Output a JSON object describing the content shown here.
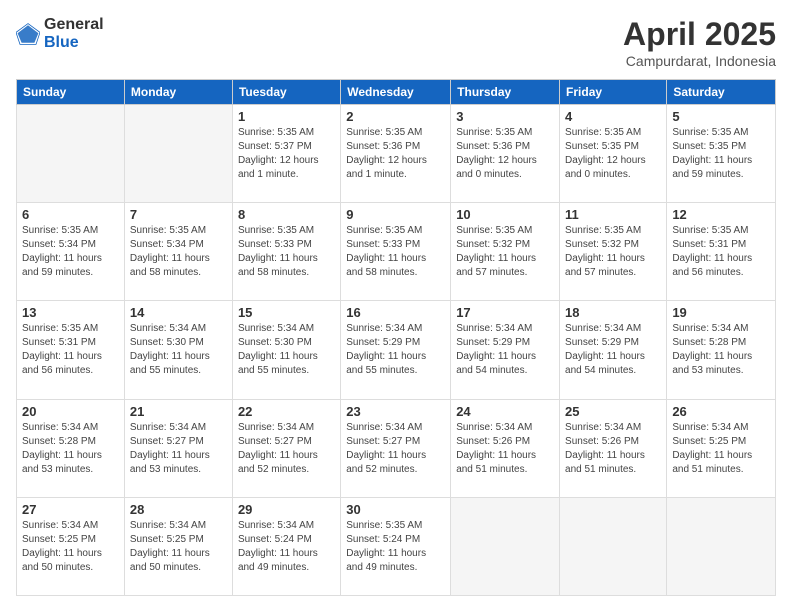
{
  "logo": {
    "general": "General",
    "blue": "Blue"
  },
  "header": {
    "title": "April 2025",
    "subtitle": "Campurdarat, Indonesia"
  },
  "columns": [
    "Sunday",
    "Monday",
    "Tuesday",
    "Wednesday",
    "Thursday",
    "Friday",
    "Saturday"
  ],
  "weeks": [
    [
      {
        "day": "",
        "info": ""
      },
      {
        "day": "",
        "info": ""
      },
      {
        "day": "1",
        "info": "Sunrise: 5:35 AM\nSunset: 5:37 PM\nDaylight: 12 hours and 1 minute."
      },
      {
        "day": "2",
        "info": "Sunrise: 5:35 AM\nSunset: 5:36 PM\nDaylight: 12 hours and 1 minute."
      },
      {
        "day": "3",
        "info": "Sunrise: 5:35 AM\nSunset: 5:36 PM\nDaylight: 12 hours and 0 minutes."
      },
      {
        "day": "4",
        "info": "Sunrise: 5:35 AM\nSunset: 5:35 PM\nDaylight: 12 hours and 0 minutes."
      },
      {
        "day": "5",
        "info": "Sunrise: 5:35 AM\nSunset: 5:35 PM\nDaylight: 11 hours and 59 minutes."
      }
    ],
    [
      {
        "day": "6",
        "info": "Sunrise: 5:35 AM\nSunset: 5:34 PM\nDaylight: 11 hours and 59 minutes."
      },
      {
        "day": "7",
        "info": "Sunrise: 5:35 AM\nSunset: 5:34 PM\nDaylight: 11 hours and 58 minutes."
      },
      {
        "day": "8",
        "info": "Sunrise: 5:35 AM\nSunset: 5:33 PM\nDaylight: 11 hours and 58 minutes."
      },
      {
        "day": "9",
        "info": "Sunrise: 5:35 AM\nSunset: 5:33 PM\nDaylight: 11 hours and 58 minutes."
      },
      {
        "day": "10",
        "info": "Sunrise: 5:35 AM\nSunset: 5:32 PM\nDaylight: 11 hours and 57 minutes."
      },
      {
        "day": "11",
        "info": "Sunrise: 5:35 AM\nSunset: 5:32 PM\nDaylight: 11 hours and 57 minutes."
      },
      {
        "day": "12",
        "info": "Sunrise: 5:35 AM\nSunset: 5:31 PM\nDaylight: 11 hours and 56 minutes."
      }
    ],
    [
      {
        "day": "13",
        "info": "Sunrise: 5:35 AM\nSunset: 5:31 PM\nDaylight: 11 hours and 56 minutes."
      },
      {
        "day": "14",
        "info": "Sunrise: 5:34 AM\nSunset: 5:30 PM\nDaylight: 11 hours and 55 minutes."
      },
      {
        "day": "15",
        "info": "Sunrise: 5:34 AM\nSunset: 5:30 PM\nDaylight: 11 hours and 55 minutes."
      },
      {
        "day": "16",
        "info": "Sunrise: 5:34 AM\nSunset: 5:29 PM\nDaylight: 11 hours and 55 minutes."
      },
      {
        "day": "17",
        "info": "Sunrise: 5:34 AM\nSunset: 5:29 PM\nDaylight: 11 hours and 54 minutes."
      },
      {
        "day": "18",
        "info": "Sunrise: 5:34 AM\nSunset: 5:29 PM\nDaylight: 11 hours and 54 minutes."
      },
      {
        "day": "19",
        "info": "Sunrise: 5:34 AM\nSunset: 5:28 PM\nDaylight: 11 hours and 53 minutes."
      }
    ],
    [
      {
        "day": "20",
        "info": "Sunrise: 5:34 AM\nSunset: 5:28 PM\nDaylight: 11 hours and 53 minutes."
      },
      {
        "day": "21",
        "info": "Sunrise: 5:34 AM\nSunset: 5:27 PM\nDaylight: 11 hours and 53 minutes."
      },
      {
        "day": "22",
        "info": "Sunrise: 5:34 AM\nSunset: 5:27 PM\nDaylight: 11 hours and 52 minutes."
      },
      {
        "day": "23",
        "info": "Sunrise: 5:34 AM\nSunset: 5:27 PM\nDaylight: 11 hours and 52 minutes."
      },
      {
        "day": "24",
        "info": "Sunrise: 5:34 AM\nSunset: 5:26 PM\nDaylight: 11 hours and 51 minutes."
      },
      {
        "day": "25",
        "info": "Sunrise: 5:34 AM\nSunset: 5:26 PM\nDaylight: 11 hours and 51 minutes."
      },
      {
        "day": "26",
        "info": "Sunrise: 5:34 AM\nSunset: 5:25 PM\nDaylight: 11 hours and 51 minutes."
      }
    ],
    [
      {
        "day": "27",
        "info": "Sunrise: 5:34 AM\nSunset: 5:25 PM\nDaylight: 11 hours and 50 minutes."
      },
      {
        "day": "28",
        "info": "Sunrise: 5:34 AM\nSunset: 5:25 PM\nDaylight: 11 hours and 50 minutes."
      },
      {
        "day": "29",
        "info": "Sunrise: 5:34 AM\nSunset: 5:24 PM\nDaylight: 11 hours and 49 minutes."
      },
      {
        "day": "30",
        "info": "Sunrise: 5:35 AM\nSunset: 5:24 PM\nDaylight: 11 hours and 49 minutes."
      },
      {
        "day": "",
        "info": ""
      },
      {
        "day": "",
        "info": ""
      },
      {
        "day": "",
        "info": ""
      }
    ]
  ]
}
